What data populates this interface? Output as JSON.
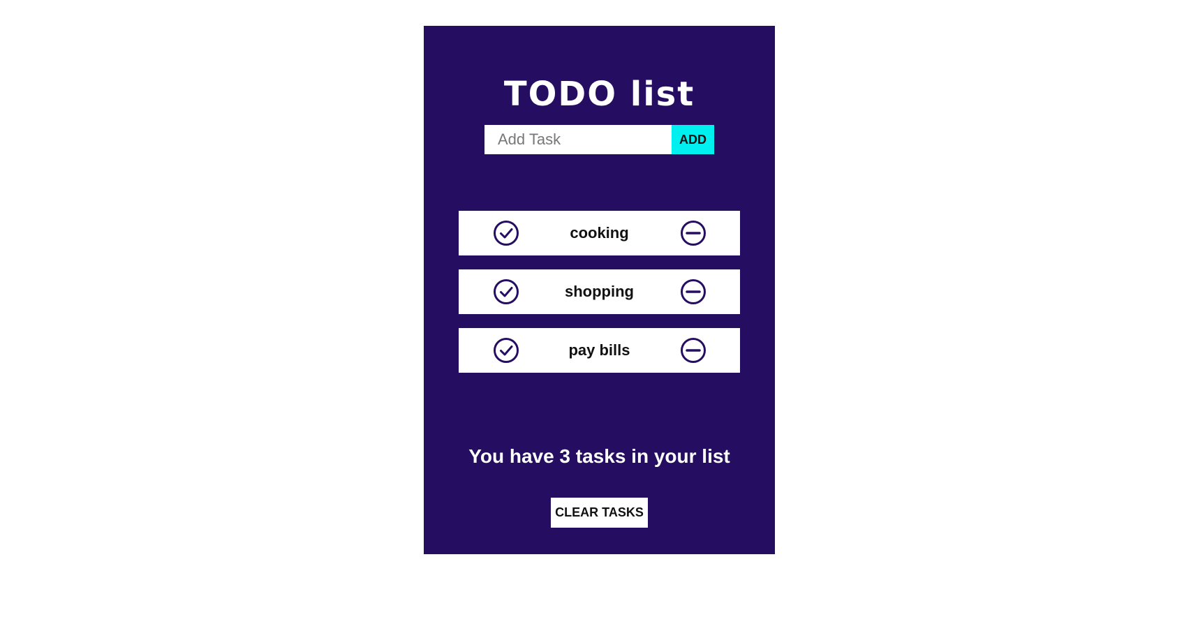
{
  "app": {
    "title": "TODO list",
    "background_color": "#250e62"
  },
  "add_form": {
    "placeholder": "Add Task",
    "value": "",
    "button_label": "ADD",
    "button_color": "#00f0f0"
  },
  "tasks": [
    {
      "label": "cooking",
      "done_icon": "check-circle-icon",
      "remove_icon": "minus-circle-icon"
    },
    {
      "label": "shopping",
      "done_icon": "check-circle-icon",
      "remove_icon": "minus-circle-icon"
    },
    {
      "label": "pay bills",
      "done_icon": "check-circle-icon",
      "remove_icon": "minus-circle-icon"
    }
  ],
  "summary": {
    "text": "You have 3 tasks in your list"
  },
  "clear_button": {
    "label": "CLEAR TASKS"
  }
}
